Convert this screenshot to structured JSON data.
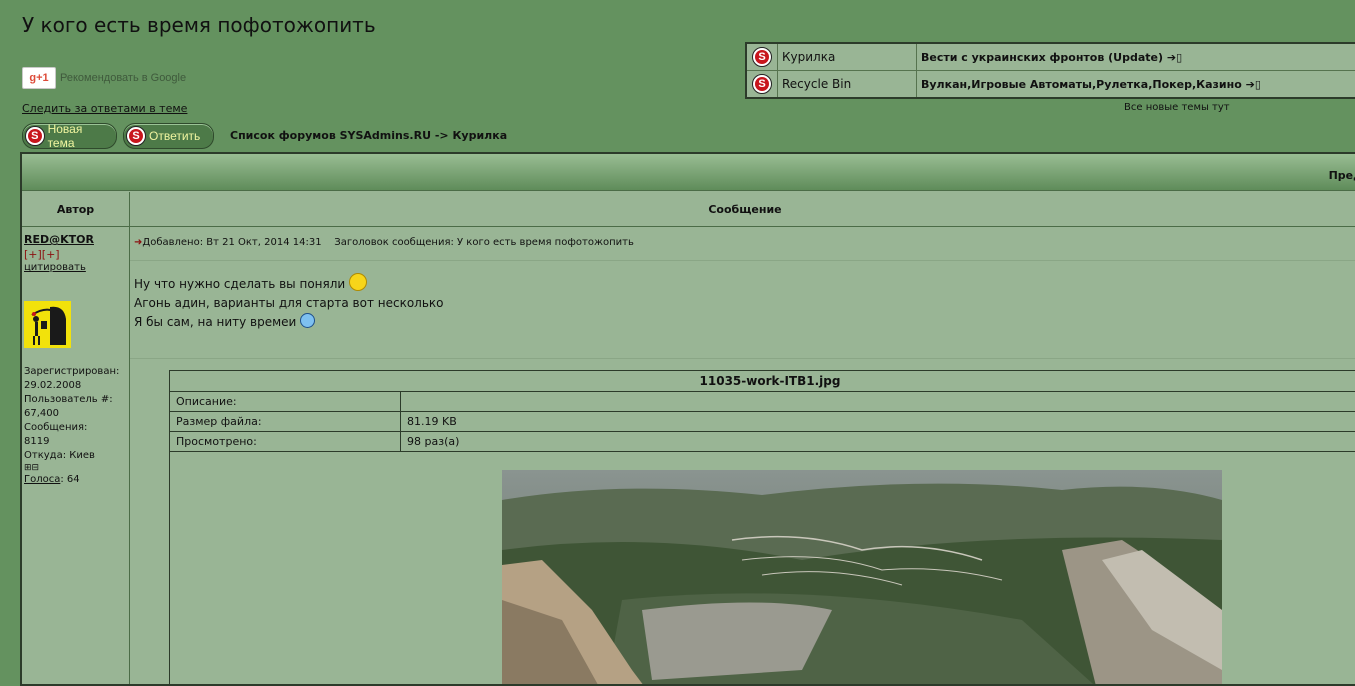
{
  "page_title": "У кого есть время пофотожопить",
  "google": {
    "badge": "g+1",
    "label": "Рекомендовать в Google"
  },
  "watch_link": "Следить за ответами в теме",
  "buttons": {
    "new_topic": "Новая тема",
    "reply": "Ответить"
  },
  "breadcrumb": "Список форумов SYSAdmins.RU -> Курилка",
  "latest_topics": [
    {
      "forum": "Курилка",
      "topic": "Вести с украинских фронтов (Update)"
    },
    {
      "forum": "Recycle Bin",
      "topic": "Вулкан,Игровые Автоматы,Рулетка,Покер,Казино"
    }
  ],
  "all_new_topics": "Все новые темы тут",
  "header_right": "Пред",
  "columns": {
    "author": "Автор",
    "message": "Сообщение"
  },
  "post": {
    "author": "RED@KTOR",
    "plus_minus": "[+][+]",
    "quote_label": "цитировать",
    "registered_label": "Зарегистрирован:",
    "registered": "29.02.2008",
    "user_no_label": "Пользователь #:",
    "user_no": "67,400",
    "messages_label": "Сообщения:",
    "messages": "8119",
    "from_label": "Откуда:",
    "from": "Киев",
    "votes_label": "Голоса",
    "votes": ": 64",
    "added": "Добавлено: Вт 21 Окт, 2014 14:31",
    "subject": "Заголовок сообщения: У кого есть время пофотожопить",
    "lines": [
      "Ну что нужно сделать вы поняли",
      "Агонь адин, варианты для старта вот несколько",
      "Я бы сам, на ниту времеи"
    ],
    "attachment": {
      "filename": "11035-work-ITB1.jpg",
      "rows": [
        {
          "label": "Описание:",
          "value": ""
        },
        {
          "label": "Размер файла:",
          "value": "81.19 KB"
        },
        {
          "label": "Просмотрено:",
          "value": "98 раз(а)"
        }
      ]
    }
  },
  "colors": {
    "page_bg": "#64925f",
    "panel_bg": "#99b595",
    "border": "#2c3b2a",
    "button_text": "#f0f5a0",
    "accent_red": "#c8161d"
  },
  "icons": [
    "s-logo-icon",
    "arrow-icon",
    "smile-icon",
    "confused-icon",
    "expand-icon"
  ]
}
